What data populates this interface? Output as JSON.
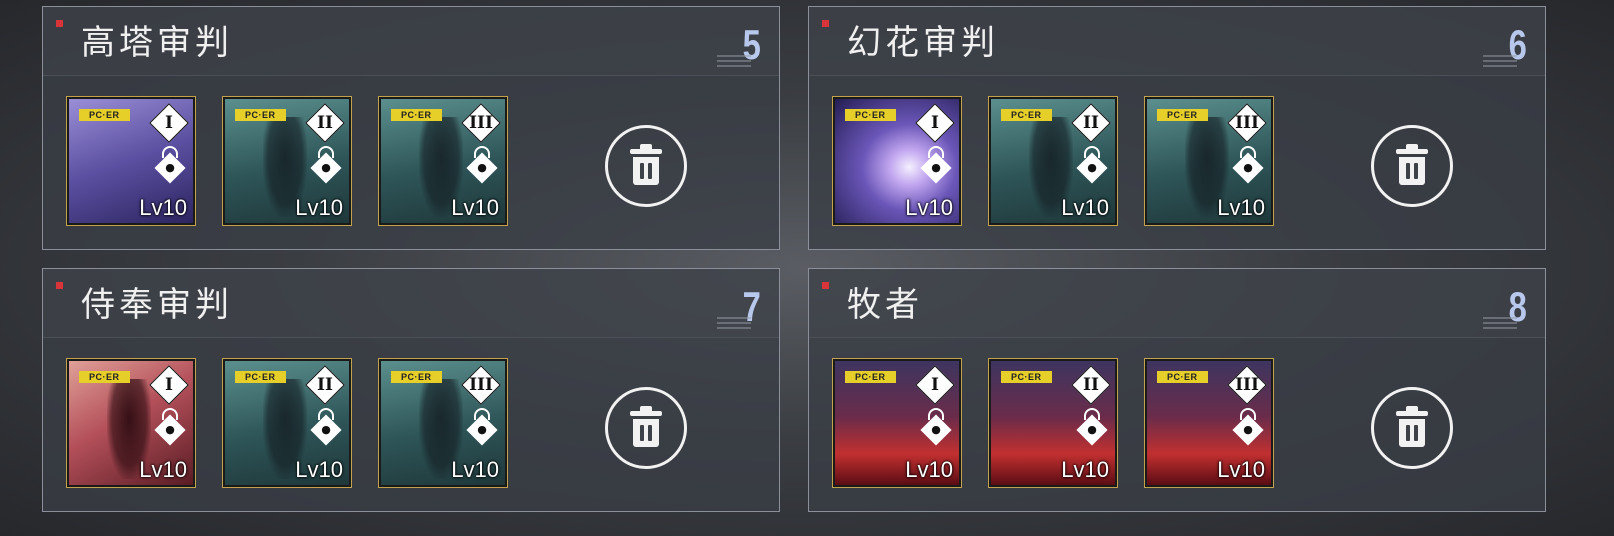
{
  "panels": [
    {
      "title": "高塔审判",
      "number": "5",
      "cards": [
        {
          "tag": "PC·ER",
          "tier": "I",
          "level": "Lv10",
          "art": "violet-fragments"
        },
        {
          "tag": "PC·ER",
          "tier": "II",
          "level": "Lv10",
          "art": "teal-figure"
        },
        {
          "tag": "PC·ER",
          "tier": "III",
          "level": "Lv10",
          "art": "teal-figure"
        }
      ]
    },
    {
      "title": "幻花审判",
      "number": "6",
      "cards": [
        {
          "tag": "PC·ER",
          "tier": "I",
          "level": "Lv10",
          "art": "violet-flare"
        },
        {
          "tag": "PC·ER",
          "tier": "II",
          "level": "Lv10",
          "art": "teal-figure"
        },
        {
          "tag": "PC·ER",
          "tier": "III",
          "level": "Lv10",
          "art": "teal-figure"
        }
      ]
    },
    {
      "title": "侍奉审判",
      "number": "7",
      "cards": [
        {
          "tag": "PC·ER",
          "tier": "I",
          "level": "Lv10",
          "art": "red-silhouettes"
        },
        {
          "tag": "PC·ER",
          "tier": "II",
          "level": "Lv10",
          "art": "teal-figure"
        },
        {
          "tag": "PC·ER",
          "tier": "III",
          "level": "Lv10",
          "art": "teal-figure"
        }
      ]
    },
    {
      "title": "牧者",
      "number": "8",
      "cards": [
        {
          "tag": "PC·ER",
          "tier": "I",
          "level": "Lv10",
          "art": "crimson-portrait"
        },
        {
          "tag": "PC·ER",
          "tier": "II",
          "level": "Lv10",
          "art": "crimson-portrait"
        },
        {
          "tag": "PC·ER",
          "tier": "III",
          "level": "Lv10",
          "art": "crimson-portrait"
        }
      ]
    }
  ],
  "icons": {
    "lock": "lock-icon",
    "delete": "trash-icon"
  },
  "colors": {
    "marker": "#d9343a",
    "number": "#b8c8ec",
    "tag": "#e7cf2a",
    "border": "#8a8f99"
  }
}
